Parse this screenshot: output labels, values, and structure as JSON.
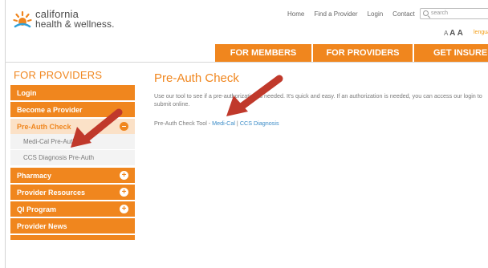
{
  "header": {
    "logo": {
      "line1": "california",
      "line2": "health & wellness."
    },
    "utility_nav": [
      "Home",
      "Find a Provider",
      "Login",
      "Contact"
    ],
    "search": {
      "placeholder": "search"
    },
    "text_size": {
      "small": "A",
      "medium": "A",
      "large": "A"
    },
    "language_link": "lengua"
  },
  "main_nav": {
    "members": "FOR MEMBERS",
    "providers": "FOR PROVIDERS",
    "insured": "GET INSURED"
  },
  "sidebar": {
    "heading": "FOR PROVIDERS",
    "items": [
      {
        "label": "Login",
        "toggle": ""
      },
      {
        "label": "Become a Provider",
        "toggle": ""
      },
      {
        "label": "Pre-Auth Check",
        "toggle": "–"
      },
      {
        "label": "Pharmacy",
        "toggle": "+"
      },
      {
        "label": "Provider Resources",
        "toggle": "+"
      },
      {
        "label": "QI Program",
        "toggle": "+"
      },
      {
        "label": "Provider News",
        "toggle": ""
      }
    ],
    "subitems": [
      {
        "label": "Medi-Cal Pre-Auth"
      },
      {
        "label": "CCS Diagnosis Pre-Auth"
      }
    ]
  },
  "content": {
    "title": "Pre-Auth Check",
    "intro": "Use our tool to see if a pre-authorization is needed. It's quick and easy. If an authorization is needed, you can access our login to submit online.",
    "tool_prefix": "Pre-Auth Check Tool - ",
    "tool_link1": "Medi-Cal",
    "tool_separator": " | ",
    "tool_link2": "CCS Diagnosis"
  },
  "colors": {
    "brand_orange": "#f0861e",
    "active_bg": "#fbe1c7",
    "link_blue": "#3a8bc7",
    "arrow_red": "#c0392b"
  }
}
